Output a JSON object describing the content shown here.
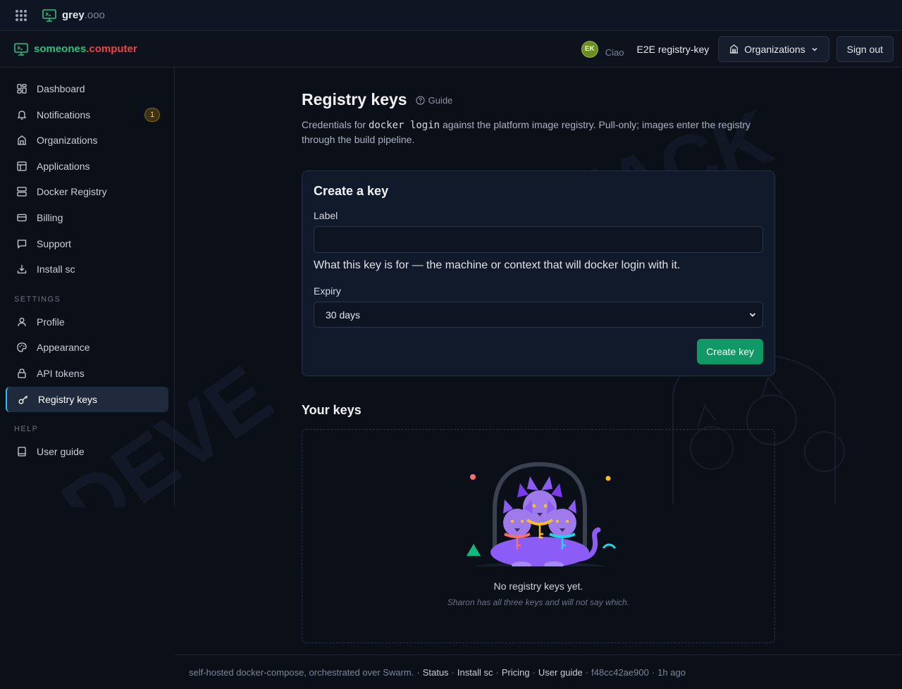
{
  "topbar": {
    "brand": "grey",
    "brand_tld": ".ooo"
  },
  "header": {
    "brand_main": "someones",
    "brand_accent": ".computer",
    "avatar_initials": "EK",
    "greeting": "Ciao",
    "user_name": "E2E registry-key",
    "org_button": "Organizations",
    "signout_button": "Sign out"
  },
  "sidebar": {
    "items": [
      {
        "label": "Dashboard",
        "icon": "dashboard-icon"
      },
      {
        "label": "Notifications",
        "icon": "bell-icon",
        "badge": "1"
      },
      {
        "label": "Organizations",
        "icon": "building-icon"
      },
      {
        "label": "Applications",
        "icon": "layout-icon"
      },
      {
        "label": "Docker Registry",
        "icon": "server-icon"
      },
      {
        "label": "Billing",
        "icon": "credit-card-icon"
      },
      {
        "label": "Support",
        "icon": "message-icon"
      },
      {
        "label": "Install sc",
        "icon": "download-icon"
      }
    ],
    "settings_label": "SETTINGS",
    "settings_items": [
      {
        "label": "Profile",
        "icon": "user-icon"
      },
      {
        "label": "Appearance",
        "icon": "palette-icon"
      },
      {
        "label": "API tokens",
        "icon": "lock-icon"
      },
      {
        "label": "Registry keys",
        "icon": "key-icon",
        "active": true
      }
    ],
    "help_label": "HELP",
    "help_items": [
      {
        "label": "User guide",
        "icon": "book-icon"
      }
    ]
  },
  "main": {
    "title": "Registry keys",
    "guide_link": "Guide",
    "desc_before": "Credentials for ",
    "desc_code": "docker login",
    "desc_after": " against the platform image registry. Pull-only; images enter the registry through the build pipeline.",
    "create_card": {
      "title": "Create a key",
      "label_field": "Label",
      "label_value": "",
      "label_hint": "What this key is for — the machine or context that will docker login with it.",
      "expiry_field": "Expiry",
      "expiry_selected": "30 days",
      "create_button": "Create key"
    },
    "keys_title": "Your keys",
    "empty_title": "No registry keys yet.",
    "empty_subtitle": "Sharon has all three keys and will not say which."
  },
  "footer": {
    "text": "self-hosted docker-compose, orchestrated over Swarm.",
    "sep": "·",
    "links": [
      "Status",
      "Install sc",
      "Pricing",
      "User guide"
    ],
    "commit": "f48cc42ae900",
    "time": "1h ago"
  },
  "colors": {
    "accent_green": "#2ec27e",
    "accent_red": "#ef4444",
    "button_green": "#109866",
    "active_border": "#38bdf8",
    "badge": "#f5c445"
  }
}
